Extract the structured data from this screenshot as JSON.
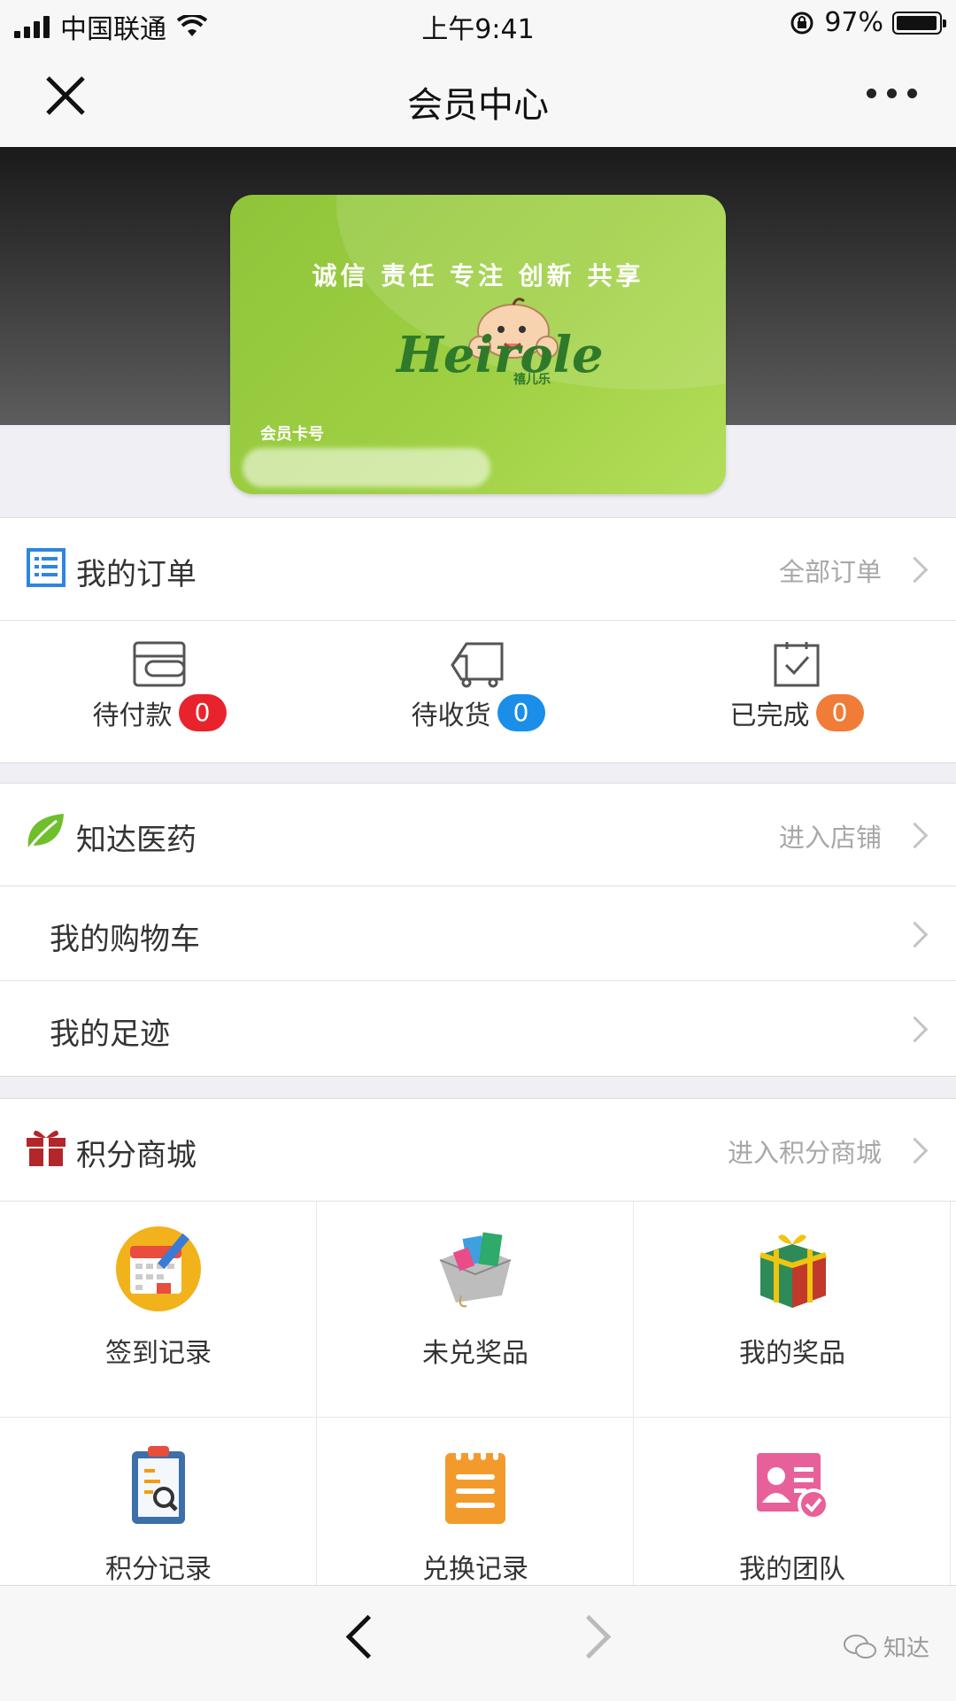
{
  "status_bar": {
    "carrier": "中国联通",
    "time": "上午9:41",
    "battery": "97%"
  },
  "nav": {
    "title": "会员中心"
  },
  "member_card": {
    "slogan": "诚信 责任 专注 创新 共享",
    "brand": "Heirole",
    "brand_sub": "禧儿乐",
    "number_label": "会员卡号"
  },
  "orders": {
    "title": "我的订单",
    "link": "全部订单",
    "statuses": [
      {
        "label": "待付款",
        "count": "0",
        "color": "#e8232c"
      },
      {
        "label": "待收货",
        "count": "0",
        "color": "#1a8ee8"
      },
      {
        "label": "已完成",
        "count": "0",
        "color": "#f07c38"
      }
    ]
  },
  "store": {
    "title": "知达医药",
    "link": "进入店铺",
    "items": [
      "我的购物车",
      "我的足迹"
    ]
  },
  "points_mall": {
    "title": "积分商城",
    "link": "进入积分商城",
    "tiles": [
      "签到记录",
      "未兑奖品",
      "我的奖品",
      "积分记录",
      "兑换记录",
      "我的团队"
    ]
  },
  "watermark": "知达",
  "colors": {
    "accent_blue": "#2d86e0",
    "leaf_green": "#6fbf2d",
    "gift_red": "#b3262a"
  }
}
